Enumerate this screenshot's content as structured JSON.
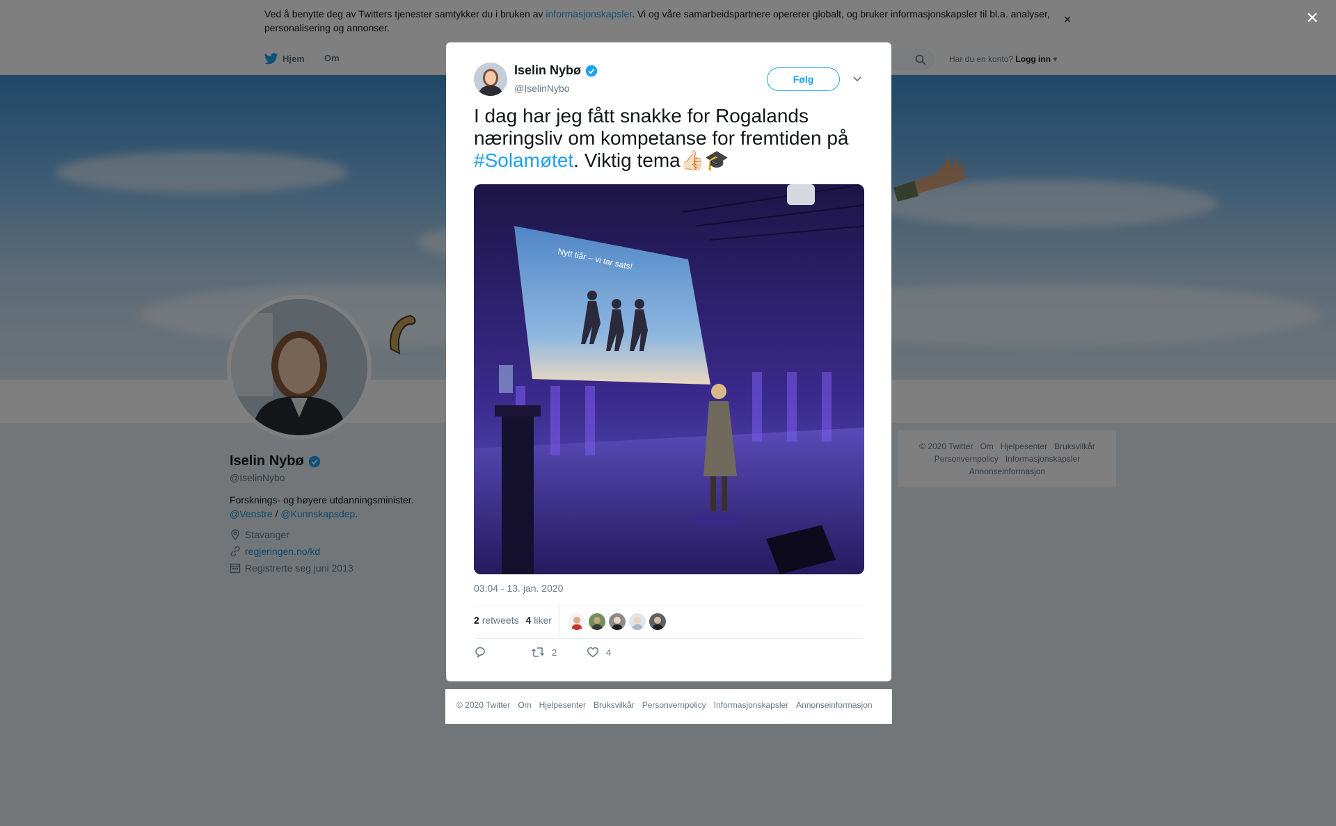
{
  "cookie": {
    "text_before": "Ved å benytte deg av Twitters tjenester samtykker du i bruken av ",
    "link": "informasjonskapsler",
    "text_after": ". Vi og våre samarbeidspartnere opererer globalt, og bruker informasjonskapsler til bl.a. analyser, personalisering og annonser.",
    "close": "×"
  },
  "nav": {
    "home": "Hjem",
    "about": "Om",
    "account_prompt": "Har du en konto?",
    "login": "Logg inn"
  },
  "profile": {
    "name": "Iselin Nybø",
    "handle": "@IselinNybo",
    "bio": "Forsknings- og høyere utdanningsminister.",
    "bio_link1": "@Venstre",
    "bio_sep": " / ",
    "bio_link2": "@Kunnskapsdep",
    "bio_end": ".",
    "location": "Stavanger",
    "website": "regjeringen.no/kd",
    "joined": "Registrerte seg juni 2013"
  },
  "side_footer": {
    "items": [
      "© 2020 Twitter",
      "Om",
      "Hjelpesenter",
      "Bruksvilkår",
      "Personvernpolicy",
      "Informasjonskapsler",
      "Annonseinformasjon"
    ]
  },
  "overlay": {
    "close": "×"
  },
  "tweet": {
    "name": "Iselin Nybø",
    "handle": "@IselinNybo",
    "follow": "Følg",
    "text_1": "I dag har jeg fått snakke for Rogalands næringsliv om kompetanse for fremtiden på ",
    "hashtag": "#Solamøtet",
    "text_2": ". Viktig tema",
    "emoji": "👍🏻🎓",
    "timestamp": "03:04 - 13. jan. 2020",
    "retweets_count": "2",
    "retweets_label": "retweets",
    "likes_count": "4",
    "likes_label": "liker",
    "action_retweets": "2",
    "action_likes": "4",
    "media_slide_text": "Nytt tiår – vi tar sats!"
  },
  "modal_footer": {
    "items": [
      "© 2020 Twitter",
      "Om",
      "Hjelpesenter",
      "Bruksvilkår",
      "Personvernpolicy",
      "Informasjonskapsler",
      "Annonseinformasjon"
    ]
  },
  "colors": {
    "accent": "#1da1f2",
    "link": "#1b95e0",
    "muted": "#657786",
    "verified": "#1da1f2"
  }
}
